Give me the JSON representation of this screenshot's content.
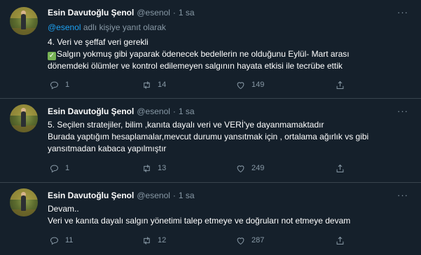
{
  "tweets": [
    {
      "name": "Esin Davutoğlu Şenol",
      "handle": "@esenol",
      "dot": "·",
      "time": "1 sa",
      "more": "···",
      "reply_to_mention": "@esenol",
      "reply_to_suffix": " adlı kişiye yanıt olarak",
      "lines": [
        "4. Veri ve şeffaf veri gerekli",
        "Salgın yokmuş gibi yaparak ödenecek bedellerin ne olduğunu Eylül- Mart arası",
        "dönemdeki ölümler ve kontrol edilemeyen salgının hayata etkisi ile tecrübe ettik"
      ],
      "check_mark": "✓",
      "replies": "1",
      "retweets": "14",
      "likes": "149"
    },
    {
      "name": "Esin Davutoğlu Şenol",
      "handle": "@esenol",
      "dot": "·",
      "time": "1 sa",
      "more": "···",
      "lines": [
        "5. Seçilen stratejiler, bilim ,kanıta dayalı veri ve VERİ'ye dayanmamaktadır",
        "Burada yaptığım hesaplamalar,mevcut durumu yansıtmak için , ortalama ağırlık vs gibi",
        "yansıtmadan kabaca yapılmıştır"
      ],
      "replies": "1",
      "retweets": "13",
      "likes": "249"
    },
    {
      "name": "Esin Davutoğlu Şenol",
      "handle": "@esenol",
      "dot": "·",
      "time": "1 sa",
      "more": "···",
      "lines": [
        "Devam..",
        "Veri ve kanıta dayalı salgın yönetimi talep etmeye ve doğruları not etmeye devam"
      ],
      "replies": "11",
      "retweets": "12",
      "likes": "287"
    }
  ],
  "colors": {
    "background": "#15202b",
    "secondary_text": "#8899a6",
    "link": "#1da1f2",
    "divider": "#38444d"
  },
  "icons": [
    "reply-icon",
    "retweet-icon",
    "like-icon",
    "share-icon",
    "more-icon",
    "check-mark-icon"
  ]
}
